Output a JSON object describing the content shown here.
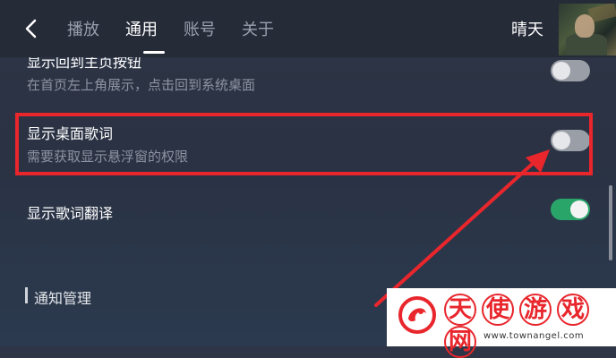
{
  "nav": {
    "tabs": [
      {
        "label": "播放"
      },
      {
        "label": "通用",
        "active": true
      },
      {
        "label": "账号"
      },
      {
        "label": "关于"
      }
    ],
    "username": "晴天"
  },
  "settings": {
    "items": [
      {
        "title": "显示回到主页按钮",
        "subtitle": "在首页左上角展示，点击回到系统桌面",
        "enabled": false
      },
      {
        "title": "显示桌面歌词",
        "subtitle": "需要获取显示悬浮窗的权限",
        "enabled": false
      },
      {
        "title": "显示歌词翻译",
        "subtitle": "",
        "enabled": true
      }
    ],
    "section_title": "通知管理"
  },
  "colors": {
    "accent_on": "#2aa56a",
    "highlight": "#e8262c"
  },
  "watermark": {
    "chars": [
      "天",
      "使",
      "游",
      "戏",
      "网"
    ],
    "url": "www.townangel.com"
  }
}
